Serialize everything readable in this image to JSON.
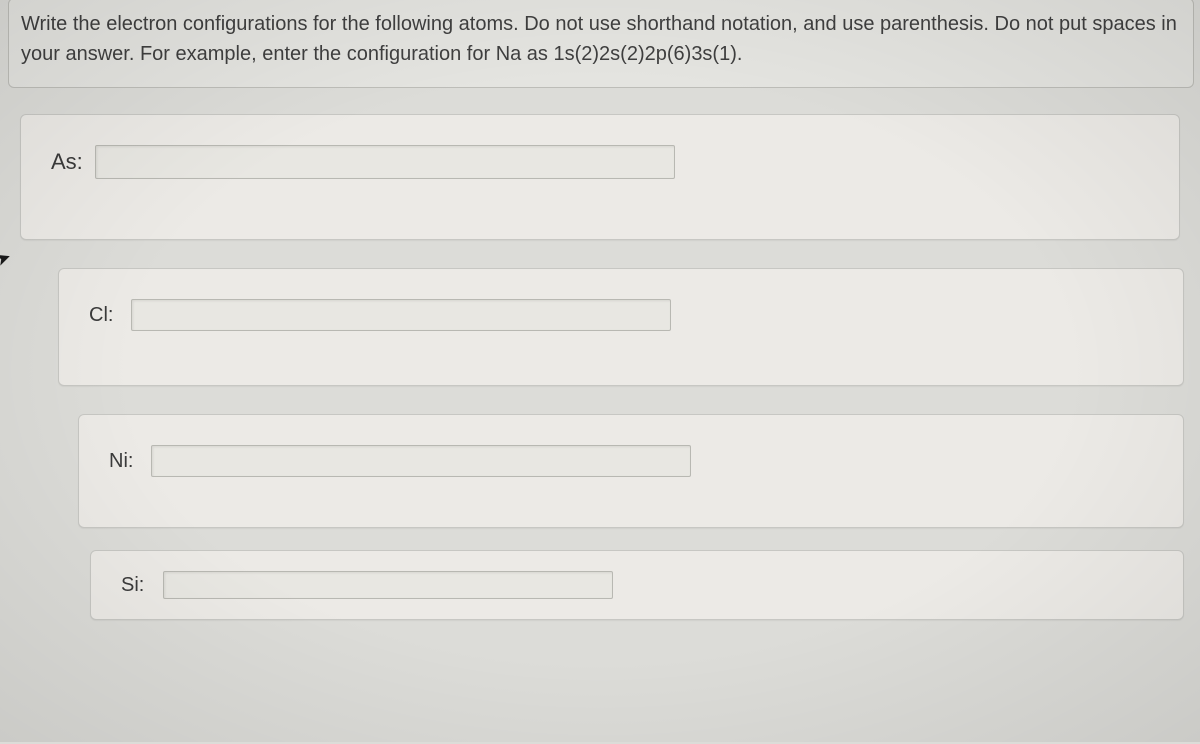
{
  "prompt": {
    "line": "Write the electron configurations for the following atoms. Do not use shorthand notation, and use parenthesis. Do not put spaces in your answer. For example, enter the configuration for Na as 1s(2)2s(2)2p(6)3s(1)."
  },
  "questions": [
    {
      "label": "As:",
      "value": ""
    },
    {
      "label": "Cl:",
      "value": ""
    },
    {
      "label": "Ni:",
      "value": ""
    },
    {
      "label": "Si:",
      "value": ""
    }
  ]
}
